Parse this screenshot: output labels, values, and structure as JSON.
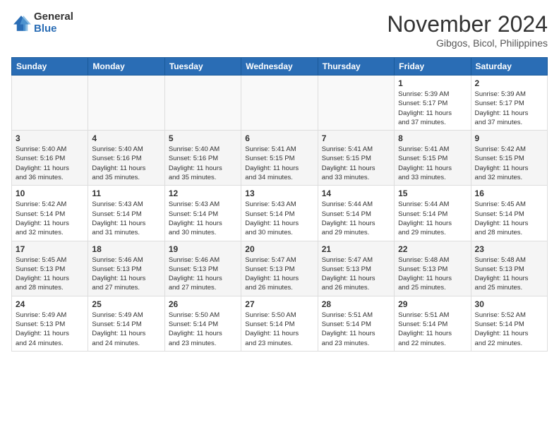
{
  "header": {
    "logo": {
      "general": "General",
      "blue": "Blue"
    },
    "title": "November 2024",
    "location": "Gibgos, Bicol, Philippines"
  },
  "weekdays": [
    "Sunday",
    "Monday",
    "Tuesday",
    "Wednesday",
    "Thursday",
    "Friday",
    "Saturday"
  ],
  "weeks": [
    [
      {
        "day": "",
        "info": ""
      },
      {
        "day": "",
        "info": ""
      },
      {
        "day": "",
        "info": ""
      },
      {
        "day": "",
        "info": ""
      },
      {
        "day": "",
        "info": ""
      },
      {
        "day": "1",
        "info": "Sunrise: 5:39 AM\nSunset: 5:17 PM\nDaylight: 11 hours\nand 37 minutes."
      },
      {
        "day": "2",
        "info": "Sunrise: 5:39 AM\nSunset: 5:17 PM\nDaylight: 11 hours\nand 37 minutes."
      }
    ],
    [
      {
        "day": "3",
        "info": "Sunrise: 5:40 AM\nSunset: 5:16 PM\nDaylight: 11 hours\nand 36 minutes."
      },
      {
        "day": "4",
        "info": "Sunrise: 5:40 AM\nSunset: 5:16 PM\nDaylight: 11 hours\nand 35 minutes."
      },
      {
        "day": "5",
        "info": "Sunrise: 5:40 AM\nSunset: 5:16 PM\nDaylight: 11 hours\nand 35 minutes."
      },
      {
        "day": "6",
        "info": "Sunrise: 5:41 AM\nSunset: 5:15 PM\nDaylight: 11 hours\nand 34 minutes."
      },
      {
        "day": "7",
        "info": "Sunrise: 5:41 AM\nSunset: 5:15 PM\nDaylight: 11 hours\nand 33 minutes."
      },
      {
        "day": "8",
        "info": "Sunrise: 5:41 AM\nSunset: 5:15 PM\nDaylight: 11 hours\nand 33 minutes."
      },
      {
        "day": "9",
        "info": "Sunrise: 5:42 AM\nSunset: 5:15 PM\nDaylight: 11 hours\nand 32 minutes."
      }
    ],
    [
      {
        "day": "10",
        "info": "Sunrise: 5:42 AM\nSunset: 5:14 PM\nDaylight: 11 hours\nand 32 minutes."
      },
      {
        "day": "11",
        "info": "Sunrise: 5:43 AM\nSunset: 5:14 PM\nDaylight: 11 hours\nand 31 minutes."
      },
      {
        "day": "12",
        "info": "Sunrise: 5:43 AM\nSunset: 5:14 PM\nDaylight: 11 hours\nand 30 minutes."
      },
      {
        "day": "13",
        "info": "Sunrise: 5:43 AM\nSunset: 5:14 PM\nDaylight: 11 hours\nand 30 minutes."
      },
      {
        "day": "14",
        "info": "Sunrise: 5:44 AM\nSunset: 5:14 PM\nDaylight: 11 hours\nand 29 minutes."
      },
      {
        "day": "15",
        "info": "Sunrise: 5:44 AM\nSunset: 5:14 PM\nDaylight: 11 hours\nand 29 minutes."
      },
      {
        "day": "16",
        "info": "Sunrise: 5:45 AM\nSunset: 5:14 PM\nDaylight: 11 hours\nand 28 minutes."
      }
    ],
    [
      {
        "day": "17",
        "info": "Sunrise: 5:45 AM\nSunset: 5:13 PM\nDaylight: 11 hours\nand 28 minutes."
      },
      {
        "day": "18",
        "info": "Sunrise: 5:46 AM\nSunset: 5:13 PM\nDaylight: 11 hours\nand 27 minutes."
      },
      {
        "day": "19",
        "info": "Sunrise: 5:46 AM\nSunset: 5:13 PM\nDaylight: 11 hours\nand 27 minutes."
      },
      {
        "day": "20",
        "info": "Sunrise: 5:47 AM\nSunset: 5:13 PM\nDaylight: 11 hours\nand 26 minutes."
      },
      {
        "day": "21",
        "info": "Sunrise: 5:47 AM\nSunset: 5:13 PM\nDaylight: 11 hours\nand 26 minutes."
      },
      {
        "day": "22",
        "info": "Sunrise: 5:48 AM\nSunset: 5:13 PM\nDaylight: 11 hours\nand 25 minutes."
      },
      {
        "day": "23",
        "info": "Sunrise: 5:48 AM\nSunset: 5:13 PM\nDaylight: 11 hours\nand 25 minutes."
      }
    ],
    [
      {
        "day": "24",
        "info": "Sunrise: 5:49 AM\nSunset: 5:13 PM\nDaylight: 11 hours\nand 24 minutes."
      },
      {
        "day": "25",
        "info": "Sunrise: 5:49 AM\nSunset: 5:14 PM\nDaylight: 11 hours\nand 24 minutes."
      },
      {
        "day": "26",
        "info": "Sunrise: 5:50 AM\nSunset: 5:14 PM\nDaylight: 11 hours\nand 23 minutes."
      },
      {
        "day": "27",
        "info": "Sunrise: 5:50 AM\nSunset: 5:14 PM\nDaylight: 11 hours\nand 23 minutes."
      },
      {
        "day": "28",
        "info": "Sunrise: 5:51 AM\nSunset: 5:14 PM\nDaylight: 11 hours\nand 23 minutes."
      },
      {
        "day": "29",
        "info": "Sunrise: 5:51 AM\nSunset: 5:14 PM\nDaylight: 11 hours\nand 22 minutes."
      },
      {
        "day": "30",
        "info": "Sunrise: 5:52 AM\nSunset: 5:14 PM\nDaylight: 11 hours\nand 22 minutes."
      }
    ]
  ]
}
